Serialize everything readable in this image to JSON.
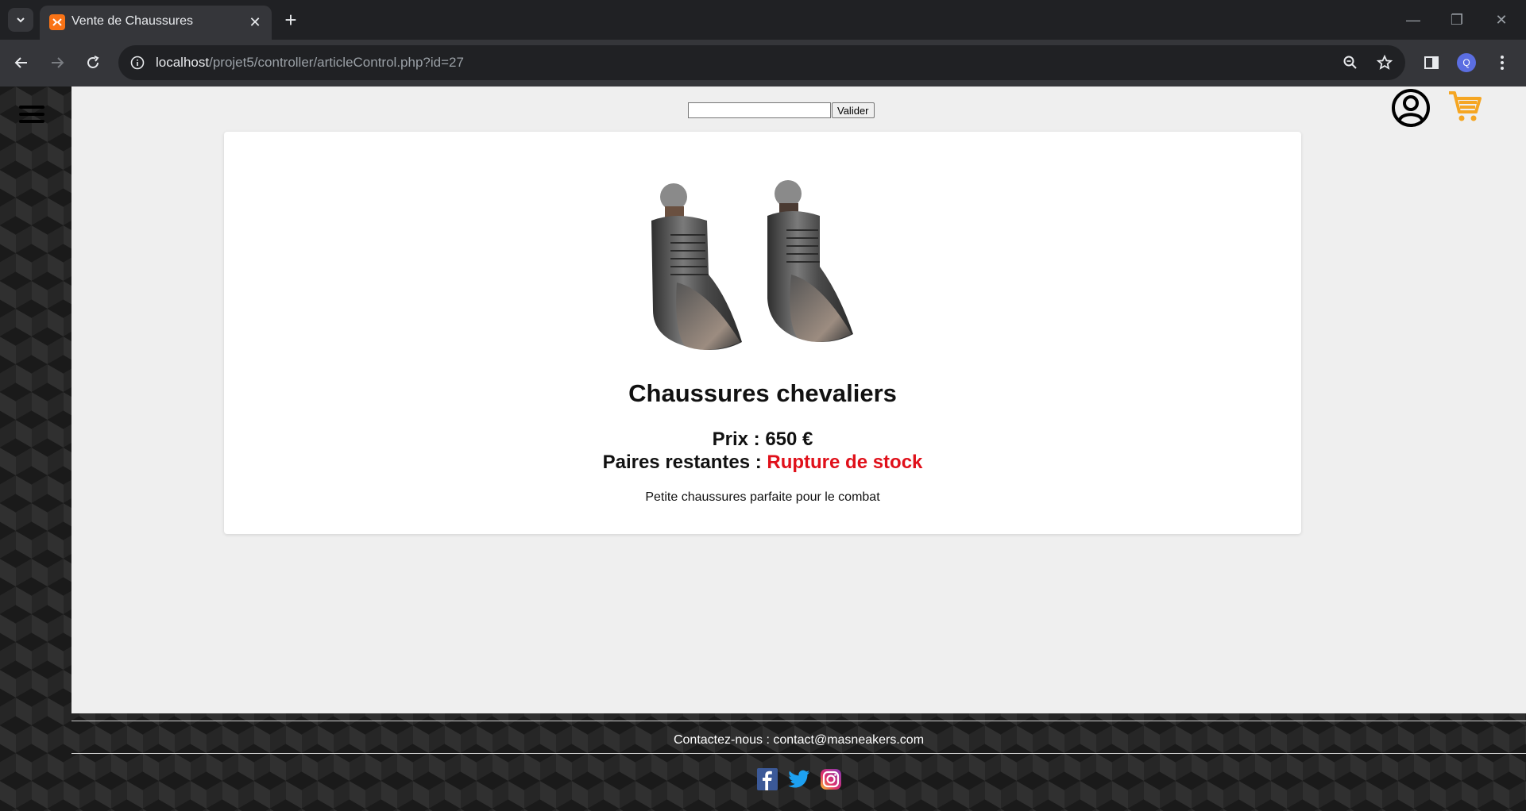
{
  "browser": {
    "tab_title": "Vente de Chaussures",
    "url_host": "localhost",
    "url_path": "/projet5/controller/articleControl.php?id=27",
    "profile_initial": "Q"
  },
  "search": {
    "placeholder": "",
    "button_label": "Valider"
  },
  "product": {
    "name": "Chaussures chevaliers",
    "price_label": "Prix : 650 €",
    "stock_label": "Paires restantes : ",
    "stock_value": "Rupture de stock",
    "description": "Petite chaussures parfaite pour le combat"
  },
  "footer": {
    "contact": "Contactez-nous : contact@masneakers.com"
  },
  "colors": {
    "stock_out": "#e0101a",
    "cart_icon": "#f5a623",
    "page_bg": "#efefef"
  }
}
